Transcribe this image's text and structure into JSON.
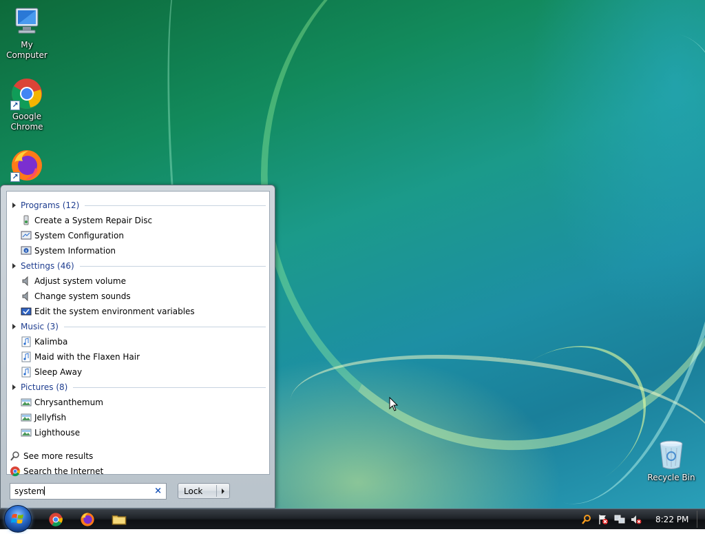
{
  "desktop": {
    "icons": [
      {
        "label": "My Computer"
      },
      {
        "label": "Google Chrome"
      },
      {
        "label": "Recycle Bin"
      }
    ]
  },
  "start_menu": {
    "categories": [
      {
        "label": "Programs (12)",
        "items": [
          "Create a System Repair Disc",
          "System Configuration",
          "System Information"
        ]
      },
      {
        "label": "Settings (46)",
        "items": [
          "Adjust system volume",
          "Change system sounds",
          "Edit the system environment variables"
        ]
      },
      {
        "label": "Music (3)",
        "items": [
          "Kalimba",
          "Maid with the Flaxen Hair",
          "Sleep Away"
        ]
      },
      {
        "label": "Pictures (8)",
        "items": [
          "Chrysanthemum",
          "Jellyfish",
          "Lighthouse"
        ]
      }
    ],
    "see_more": "See more results",
    "search_internet": "Search the Internet",
    "search_value": "system",
    "clear_symbol": "×",
    "lock_label": "Lock"
  },
  "taskbar": {
    "clock": "8:22 PM"
  },
  "colors": {
    "category_text": "#1e3d8f",
    "accent_blue": "#1c56b8"
  }
}
